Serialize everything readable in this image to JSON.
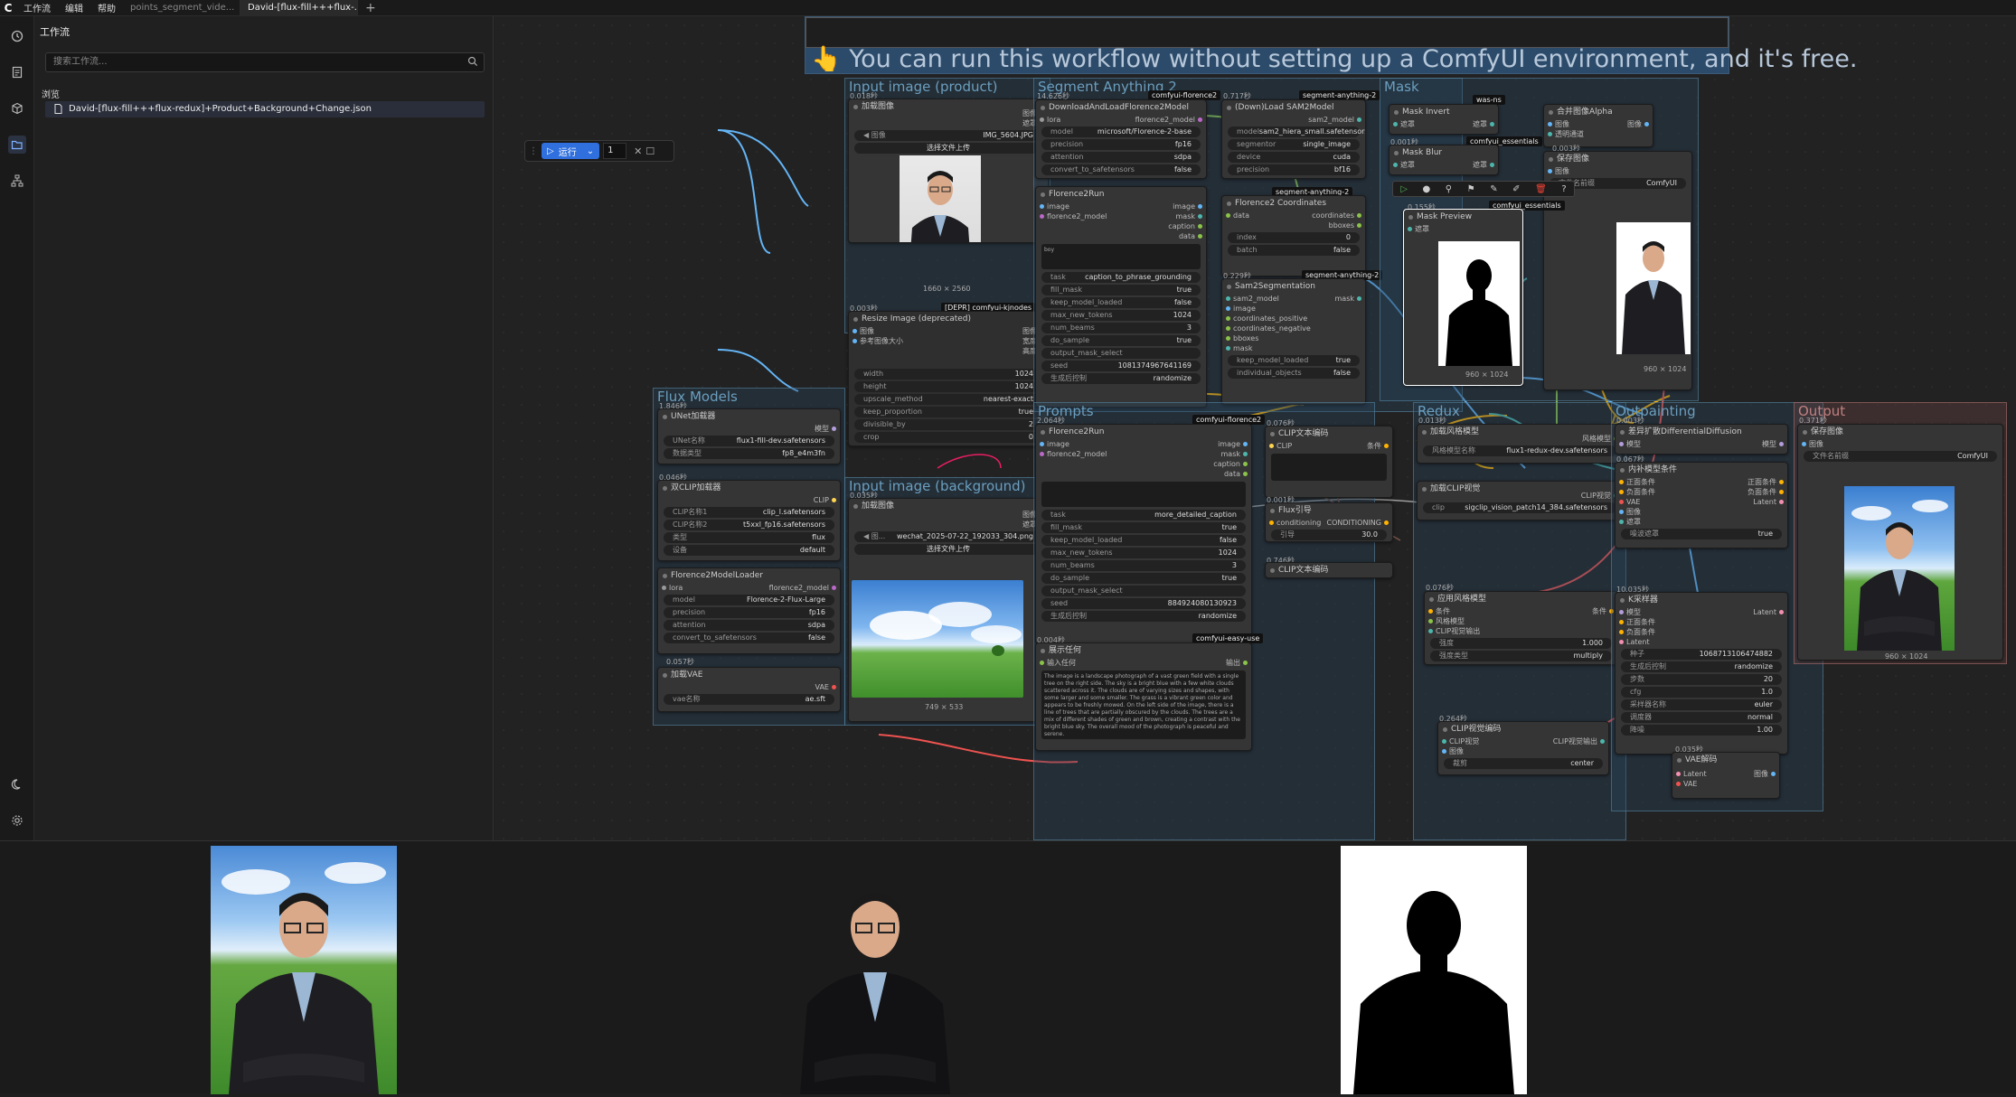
{
  "topbar": {
    "menus": [
      "工作流",
      "编辑",
      "帮助"
    ],
    "tabs": [
      {
        "label": "points_segment_vide...",
        "active": false
      },
      {
        "label": "David-[flux-fill+++flux-...",
        "active": true
      }
    ]
  },
  "sidebar": {
    "title": "工作流",
    "search_placeholder": "搜索工作流...",
    "browse_label": "浏览",
    "file": "David-[flux-fill+++flux-redux]+Product+Background+Change.json"
  },
  "runbar": {
    "run_label": "运行",
    "count": "1"
  },
  "banner": {
    "text": "You can run this workflow without setting up a ComfyUI environment, and it's free."
  },
  "groups": {
    "input_product": "Input image (product)",
    "segment": "Segment Anything 2",
    "mask": "Mask",
    "flux_models": "Flux Models",
    "input_bg": "Input image (background)",
    "prompts": "Prompts",
    "redux": "Redux",
    "outpainting": "Outpainting",
    "output": "Output"
  },
  "nodes": {
    "load_product": {
      "title": "加载图像",
      "image": "IMG_5604.JPG",
      "upload": "选择文件上传",
      "size": "1660 × 2560",
      "timing": "0.018秒",
      "out1": "图像",
      "out2": "遮罩"
    },
    "resize": {
      "title": "Resize Image (deprecated)",
      "badge": "[DEPR] comfyui-kjnodes",
      "timing": "0.003秒",
      "in1": "图像",
      "in2": "参考图像大小",
      "out1": "图像",
      "out2": "宽度",
      "out3": "高度",
      "rows": [
        [
          "width",
          "1024"
        ],
        [
          "height",
          "1024"
        ],
        [
          "upscale_method",
          "nearest-exact"
        ],
        [
          "keep_proportion",
          "true"
        ],
        [
          "divisible_by",
          "2"
        ],
        [
          "crop",
          "0"
        ]
      ]
    },
    "flor_load": {
      "title": "DownloadAndLoadFlorence2Model",
      "badge": "comfyui-florence2",
      "timing": "14.626秒",
      "in": "lora",
      "out": "florence2_model",
      "rows": [
        [
          "model",
          "microsoft/Florence-2-base"
        ],
        [
          "precision",
          "fp16"
        ],
        [
          "attention",
          "sdpa"
        ],
        [
          "convert_to_safetensors",
          "false"
        ]
      ]
    },
    "flor_run": {
      "title": "Florence2Run",
      "ins": [
        "image",
        "florence2_model"
      ],
      "outs": [
        "image",
        "mask",
        "caption",
        "data"
      ],
      "text": "boy",
      "rows": [
        [
          "task",
          "caption_to_phrase_grounding"
        ],
        [
          "fill_mask",
          "true"
        ],
        [
          "keep_model_loaded",
          "false"
        ],
        [
          "max_new_tokens",
          "1024"
        ],
        [
          "num_beams",
          "3"
        ],
        [
          "do_sample",
          "true"
        ],
        [
          "output_mask_select",
          ""
        ],
        [
          "seed",
          "1081374967641169"
        ],
        [
          "生成后控制",
          "randomize"
        ]
      ]
    },
    "sam_load": {
      "title": "(Down)Load SAM2Model",
      "badge": "segment-anything-2",
      "timing": "0.717秒",
      "out": "sam2_model",
      "rows": [
        [
          "model",
          "sam2_hiera_small.safetensors"
        ],
        [
          "segmentor",
          "single_image"
        ],
        [
          "device",
          "cuda"
        ],
        [
          "precision",
          "bf16"
        ]
      ]
    },
    "flor_coords": {
      "title": "Florence2 Coordinates",
      "badge": "segment-anything-2",
      "in": "data",
      "outs": [
        "coordinates",
        "bboxes"
      ],
      "rows": [
        [
          "index",
          "0"
        ],
        [
          "batch",
          "false"
        ]
      ]
    },
    "sam_seg": {
      "title": "Sam2Segmentation",
      "badge": "segment-anything-2",
      "timing": "0.229秒",
      "ins": [
        "sam2_model",
        "image",
        "coordinates_positive",
        "coordinates_negative",
        "bboxes",
        "mask"
      ],
      "out": "mask",
      "rows": [
        [
          "keep_model_loaded",
          "true"
        ],
        [
          "individual_objects",
          "false"
        ]
      ]
    },
    "mask_invert": {
      "title": "Mask Invert",
      "badge": "was-ns",
      "timing": "0.001秒",
      "in": "遮罩",
      "out": "遮罩"
    },
    "mask_blur": {
      "title": "Mask Blur",
      "badge": "comfyui_essentials",
      "in": "遮罩",
      "out": "遮罩"
    },
    "join_alpha": {
      "title": "合并图像Alpha",
      "ins": [
        "图像",
        "透明通道"
      ],
      "out": "图像"
    },
    "save_img": {
      "title": "保存图像",
      "timing": "0.003秒",
      "in": "图像",
      "row": [
        "文件名前缀",
        "ComfyUI"
      ],
      "size": "960 × 1024"
    },
    "mask_prev": {
      "title": "Mask Preview",
      "badge": "comfyui_essentials",
      "timing": "0.155秒",
      "in": "遮罩",
      "size": "960 × 1024"
    },
    "flux_unet": {
      "title": "UNet加载器",
      "timing": "1.846秒",
      "out": "模型",
      "rows": [
        [
          "UNet名称",
          "flux1-fill-dev.safetensors"
        ],
        [
          "数据类型",
          "fp8_e4m3fn"
        ]
      ]
    },
    "dual_clip": {
      "title": "双CLIP加载器",
      "timing": "0.046秒",
      "out": "CLIP",
      "rows": [
        [
          "CLIP名称1",
          "clip_l.safetensors"
        ],
        [
          "CLIP名称2",
          "t5xxl_fp16.safetensors"
        ],
        [
          "类型",
          "flux"
        ],
        [
          "设备",
          "default"
        ]
      ]
    },
    "flor_loader": {
      "title": "Florence2ModelLoader",
      "in": "lora",
      "out": "florence2_model",
      "rows": [
        [
          "model",
          "Florence-2-Flux-Large"
        ],
        [
          "precision",
          "fp16"
        ],
        [
          "attention",
          "sdpa"
        ],
        [
          "convert_to_safetensors",
          "false"
        ]
      ],
      "timing": "0.057秒"
    },
    "vae_load": {
      "title": "加载VAE",
      "out": "VAE",
      "row": [
        "vae名称",
        "ae.sft"
      ]
    },
    "load_bg": {
      "title": "加载图像",
      "timing": "0.035秒",
      "image": "wechat_2025-07-22_192033_304.png",
      "upload": "选择文件上传",
      "size": "749 × 533",
      "out1": "图像",
      "out2": "遮罩"
    },
    "prompts_flor": {
      "title": "Florence2Run",
      "badge": "comfyui-florence2",
      "timing": "2.064秒",
      "ins": [
        "image",
        "florence2_model"
      ],
      "outs": [
        "image",
        "mask",
        "caption",
        "data"
      ],
      "rows": [
        [
          "task",
          "more_detailed_caption"
        ],
        [
          "fill_mask",
          "true"
        ],
        [
          "keep_model_loaded",
          "false"
        ],
        [
          "max_new_tokens",
          "1024"
        ],
        [
          "num_beams",
          "3"
        ],
        [
          "do_sample",
          "true"
        ],
        [
          "output_mask_select",
          ""
        ],
        [
          "seed",
          "884924080130923"
        ],
        [
          "生成后控制",
          "randomize"
        ]
      ]
    },
    "show_text": {
      "title": "展示任何",
      "badge": "comfyui-easy-use",
      "timing": "0.004秒",
      "in": "输入任何",
      "out": "输出",
      "text": "The image is a landscape photograph of a vast green field with a single tree on the right side. The sky is a bright blue with a few white clouds scattered across it. The clouds are of varying sizes and shapes, with some larger and some smaller. The grass is a vibrant green color and appears to be freshly mowed. On the left side of the image, there is a line of trees that are partially obscured by the clouds. The trees are a mix of different shades of green and brown, creating a contrast with the bright blue sky. The overall mood of the photograph is peaceful and serene."
    },
    "clip_enc1": {
      "title": "CLIP文本编码",
      "timing": "0.076秒",
      "in": "CLIP",
      "out": "条件"
    },
    "flux_guide": {
      "title": "Flux引导",
      "timing": "0.001秒",
      "in": "conditioning",
      "out": "CONDITIONING",
      "row": [
        "引导",
        "30.0"
      ]
    },
    "clip_enc2": {
      "title": "CLIP文本编码",
      "timing": "0.746秒"
    },
    "style_load": {
      "title": "加载风格模型",
      "timing": "0.013秒",
      "out": "风格模型",
      "row": [
        "风格模型名称",
        "flux1-redux-dev.safetensors"
      ]
    },
    "clipv_load": {
      "title": "加载CLIP视觉",
      "out": "CLIP视觉",
      "row": [
        "clip",
        "sigclip_vision_patch14_384.safetensors"
      ]
    },
    "apply_style": {
      "title": "应用风格模型",
      "timing": "0.076秒",
      "ins": [
        "条件",
        "风格模型",
        "CLIP视觉输出"
      ],
      "out": "条件",
      "rows": [
        [
          "强度",
          "1.000"
        ],
        [
          "强度类型",
          "multiply"
        ]
      ]
    },
    "clipv_enc": {
      "title": "CLIP视觉编码",
      "timing": "0.264秒",
      "ins": [
        "CLIP视觉",
        "图像"
      ],
      "out": "CLIP视觉输出",
      "row": [
        "裁剪",
        "center"
      ]
    },
    "diff_diff": {
      "title": "差异扩散DifferentialDiffusion",
      "timing": "0.003秒",
      "in": "模型",
      "out": "模型"
    },
    "inpaint_cond": {
      "title": "内补模型条件",
      "timing": "0.067秒",
      "ins": [
        "正面条件",
        "负面条件",
        "VAE",
        "图像",
        "遮罩"
      ],
      "outs": [
        "正面条件",
        "负面条件",
        "Latent"
      ],
      "row": [
        "噪波遮罩",
        "true"
      ]
    },
    "ksampler": {
      "title": "K采样器",
      "timing": "10.035秒",
      "ins": [
        "模型",
        "正面条件",
        "负面条件",
        "Latent"
      ],
      "out": "Latent",
      "rows": [
        [
          "种子",
          "1068713106474882"
        ],
        [
          "生成后控制",
          "randomize"
        ],
        [
          "步数",
          "20"
        ],
        [
          "cfg",
          "1.0"
        ],
        [
          "采样器名称",
          "euler"
        ],
        [
          "调度器",
          "normal"
        ],
        [
          "降噪",
          "1.00"
        ]
      ]
    },
    "vae_dec": {
      "title": "VAE解码",
      "timing": "0.035秒",
      "ins": [
        "Latent",
        "VAE"
      ],
      "out": "图像"
    },
    "out_save": {
      "title": "保存图像",
      "timing": "0.371秒",
      "in": "图像",
      "row": [
        "文件名前缀",
        "ComfyUI"
      ],
      "size": "960 × 1024"
    }
  },
  "icons": [
    "history-icon",
    "document-icon",
    "cube-icon",
    "folder-open-icon",
    "network-icon",
    "moon-icon",
    "gear-icon"
  ]
}
